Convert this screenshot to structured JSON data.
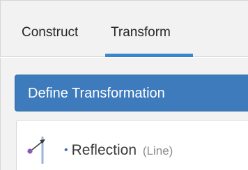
{
  "tabs": [
    {
      "label": "Construct",
      "active": false
    },
    {
      "label": "Transform",
      "active": true
    }
  ],
  "accent_color": "#3b86c9",
  "define_button": {
    "label": "Define Transformation",
    "color": "#3e7bbd"
  },
  "tool": {
    "icon": "reflection-icon",
    "bullet": "•",
    "name": "Reflection",
    "qualifier": "(Line)"
  }
}
